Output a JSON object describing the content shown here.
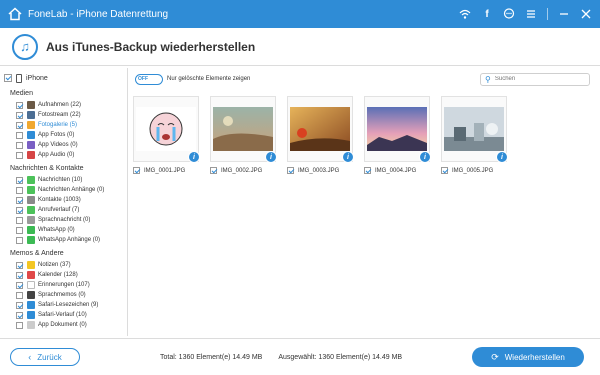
{
  "titlebar": {
    "title": "FoneLab - iPhone Datenrettung",
    "icons": [
      "wifi-icon",
      "facebook-icon",
      "chat-icon",
      "menu-icon",
      "minimize-icon",
      "close-icon"
    ]
  },
  "header": {
    "title": "Aus iTunes-Backup wiederherstellen"
  },
  "sidebar": {
    "root_label": "iPhone",
    "groups": [
      {
        "title": "Medien",
        "items": [
          {
            "label": "Aufnahmen (22)",
            "checked": true,
            "color": "#6b5a46"
          },
          {
            "label": "Fotostream (22)",
            "checked": true,
            "color": "#4c6e94"
          },
          {
            "label": "Fotogalerie (5)",
            "checked": true,
            "color": "#f0a830",
            "selected": true
          },
          {
            "label": "App Fotos (0)",
            "checked": false,
            "color": "#2f8cd6"
          },
          {
            "label": "App Videos (0)",
            "checked": false,
            "color": "#7a5fc4"
          },
          {
            "label": "App Audio (0)",
            "checked": false,
            "color": "#d64545"
          }
        ]
      },
      {
        "title": "Nachrichten & Kontakte",
        "items": [
          {
            "label": "Nachrichten (10)",
            "checked": true,
            "color": "#4cc25a"
          },
          {
            "label": "Nachrichten Anhänge (0)",
            "checked": false,
            "color": "#4cc25a"
          },
          {
            "label": "Kontakte (1003)",
            "checked": true,
            "color": "#8a8a8a"
          },
          {
            "label": "Anrufverlauf (7)",
            "checked": true,
            "color": "#4cc25a"
          },
          {
            "label": "Sprachnachricht (0)",
            "checked": false,
            "color": "#9a9a9a"
          },
          {
            "label": "WhatsApp (0)",
            "checked": false,
            "color": "#3cba54"
          },
          {
            "label": "WhatsApp Anhänge (0)",
            "checked": false,
            "color": "#3cba54"
          }
        ]
      },
      {
        "title": "Memos & Andere",
        "items": [
          {
            "label": "Notizen (37)",
            "checked": true,
            "color": "#f3c623"
          },
          {
            "label": "Kalender (128)",
            "checked": true,
            "color": "#e04848"
          },
          {
            "label": "Erinnerungen (107)",
            "checked": true,
            "color": "#ffffff"
          },
          {
            "label": "Sprachmemos (0)",
            "checked": false,
            "color": "#444444"
          },
          {
            "label": "Safari-Lesezeichen (9)",
            "checked": true,
            "color": "#2f8cd6"
          },
          {
            "label": "Safari-Verlauf (10)",
            "checked": true,
            "color": "#2f8cd6"
          },
          {
            "label": "App Dokument (0)",
            "checked": false,
            "color": "#cccccc"
          }
        ]
      }
    ]
  },
  "toolbar": {
    "toggle_state": "OFF",
    "filter_label": "Nur gelöschte Elemente zeigen",
    "search_placeholder": "Suchen"
  },
  "photos": [
    {
      "name": "IMG_0001.JPG",
      "checked": true
    },
    {
      "name": "IMG_0002.JPG",
      "checked": true
    },
    {
      "name": "IMG_0003.JPG",
      "checked": true
    },
    {
      "name": "IMG_0004.JPG",
      "checked": true
    },
    {
      "name": "IMG_0005.JPG",
      "checked": true
    }
  ],
  "footer": {
    "back_label": "Zurück",
    "total_text": "Total: 1360 Element(e) 14.49 MB",
    "selected_text": "Ausgewählt: 1360 Element(e) 14.49 MB",
    "restore_label": "Wiederherstellen"
  },
  "colors": {
    "accent": "#2f8cd6"
  }
}
